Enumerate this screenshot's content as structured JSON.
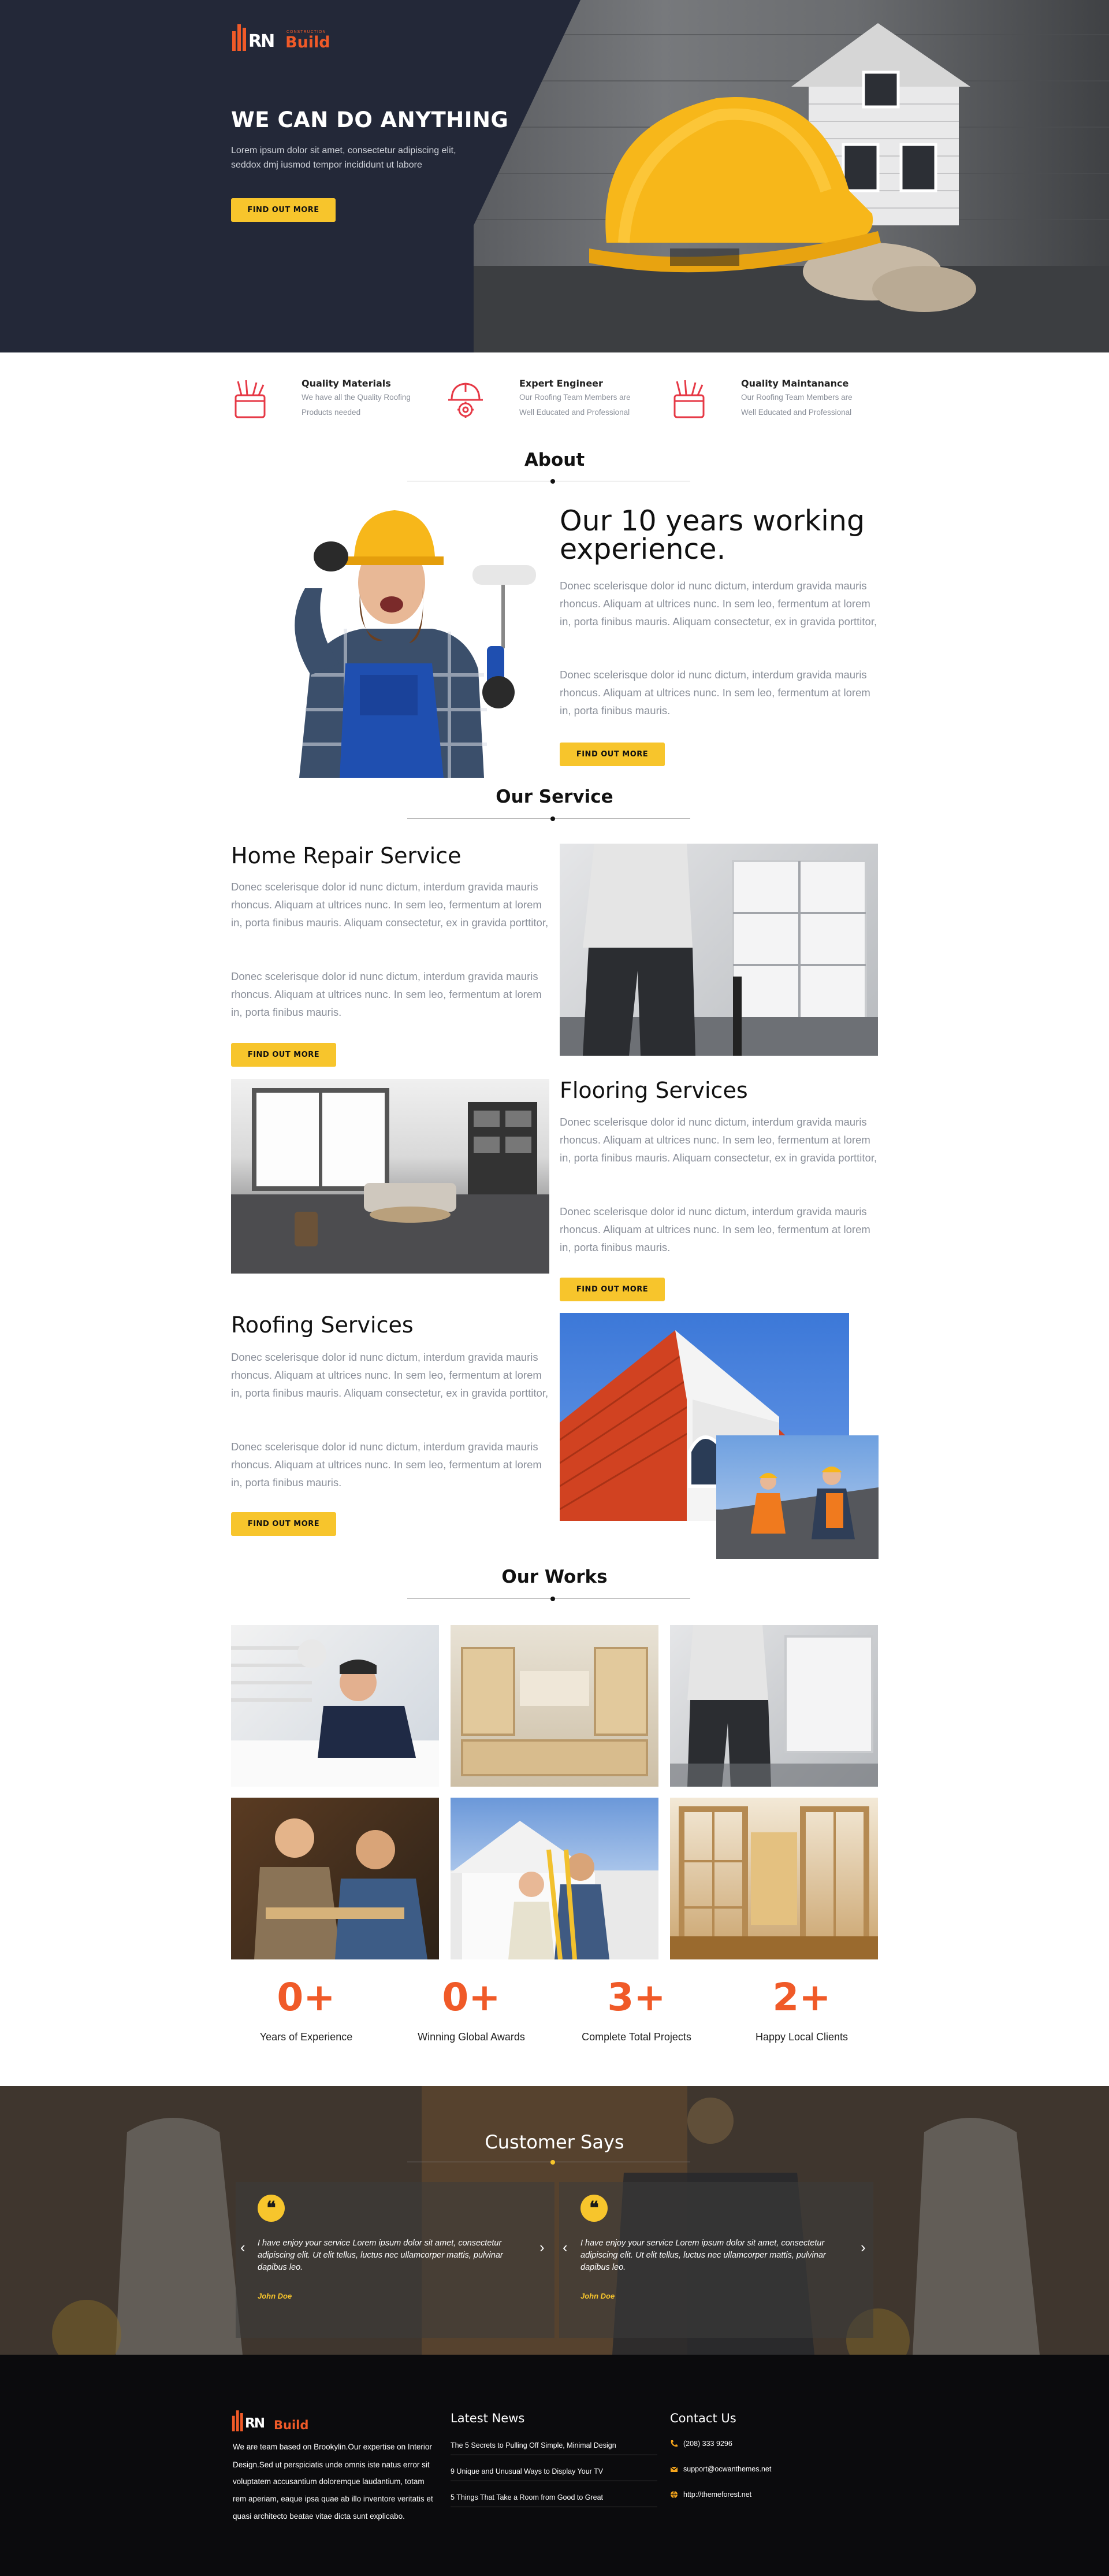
{
  "brand": {
    "logo_text": "Build",
    "tagline": "CONSTRUCTION"
  },
  "hero": {
    "title": "WE CAN DO ANYTHING",
    "text_line1": "Lorem ipsum dolor sit amet, consectetur adipiscing elit,",
    "text_line2": "seddox dmj iusmod tempor incididunt ut labore",
    "button": "FIND OUT MORE"
  },
  "features": [
    {
      "title": "Quality Materials",
      "line1": "We have all the Quality Roofing",
      "line2": "Products needed",
      "icon": "toolbox-icon"
    },
    {
      "title": "Expert Engineer",
      "line1": "Our Roofing Team Members are",
      "line2": "Well Educated and Professional",
      "icon": "hardhat-gear-icon"
    },
    {
      "title": "Quality Maintanance",
      "line1": "Our Roofing Team Members are",
      "line2": "Well Educated and Professional",
      "icon": "toolbox-icon"
    }
  ],
  "about": {
    "section_title": "About",
    "heading_line1": "Our 10 years working",
    "heading_line2": "experience.",
    "para1": "Donec scelerisque dolor id nunc dictum, interdum gravida mauris rhoncus. Aliquam at ultrices nunc. In sem leo, fermentum at lorem in, porta finibus mauris. Aliquam consectetur, ex in gravida porttitor,",
    "para2": "Donec scelerisque dolor id nunc dictum, interdum gravida mauris rhoncus. Aliquam at ultrices nunc. In sem leo, fermentum at lorem in, porta finibus mauris.",
    "button": "FIND OUT MORE"
  },
  "services": {
    "section_title": "Our Service",
    "items": [
      {
        "title": "Home Repair Service",
        "para1": "Donec scelerisque dolor id nunc dictum, interdum gravida mauris rhoncus. Aliquam at ultrices nunc. In sem leo, fermentum at lorem in, porta finibus mauris. Aliquam consectetur, ex in gravida porttitor,",
        "para2": "Donec scelerisque dolor id nunc dictum, interdum gravida mauris rhoncus. Aliquam at ultrices nunc. In sem leo, fermentum at lorem in, porta finibus mauris.",
        "button": "FIND OUT MORE"
      },
      {
        "title": "Flooring Services",
        "para1": "Donec scelerisque dolor id nunc dictum, interdum gravida mauris rhoncus. Aliquam at ultrices nunc. In sem leo, fermentum at lorem in, porta finibus mauris. Aliquam consectetur, ex in gravida porttitor,",
        "para2": "Donec scelerisque dolor id nunc dictum, interdum gravida mauris rhoncus. Aliquam at ultrices nunc. In sem leo, fermentum at lorem in, porta finibus mauris.",
        "button": "FIND OUT MORE"
      },
      {
        "title": "Roofing Services",
        "para1": "Donec scelerisque dolor id nunc dictum, interdum gravida mauris rhoncus. Aliquam at ultrices nunc. In sem leo, fermentum at lorem in, porta finibus mauris. Aliquam consectetur, ex in gravida porttitor,",
        "para2": "Donec scelerisque dolor id nunc dictum, interdum gravida mauris rhoncus. Aliquam at ultrices nunc. In sem leo, fermentum at lorem in, porta finibus mauris.",
        "button": "FIND OUT MORE"
      }
    ]
  },
  "works": {
    "section_title": "Our Works"
  },
  "counters": [
    {
      "value": "0+",
      "label": "Years of Experience"
    },
    {
      "value": "0+",
      "label": "Winning Global Awards"
    },
    {
      "value": "3+",
      "label": "Complete Total Projects"
    },
    {
      "value": "2+",
      "label": "Happy Local Clients"
    }
  ],
  "testimonials": {
    "section_title": "Customer Says",
    "items": [
      {
        "quote": "I have enjoy your service Lorem ipsum dolor sit amet, consectetur adipiscing elit. Ut elit tellus, luctus nec ullamcorper mattis, pulvinar dapibus leo.",
        "author": "John Doe"
      },
      {
        "quote": "I have enjoy your service Lorem ipsum dolor sit amet, consectetur adipiscing elit. Ut elit tellus, luctus nec ullamcorper mattis, pulvinar dapibus leo.",
        "author": "John Doe"
      }
    ],
    "prev": "‹",
    "next": "›"
  },
  "footer": {
    "about_line1": "We are team based on Brookylin.Our expertise on Interior",
    "about_line2": "Design.Sed ut perspiciatis unde omnis iste natus error sit",
    "about_line3": "voluptatem accusantium doloremque laudantium, totam",
    "about_line4": "rem aperiam, eaque ipsa quae ab illo inventore veritatis et",
    "about_line5": "quasi architecto beatae vitae dicta sunt explicabo.",
    "news_title": "Latest News",
    "news": [
      "The 5 Secrets to Pulling Off Simple, Minimal Design",
      "9 Unique and Unusual Ways to Display Your TV",
      "5 Things That Take a Room from Good to Great"
    ],
    "contact_title": "Contact Us",
    "phone": "(208) 333 9296",
    "email": "support@ocwanthemes.net",
    "website": "http://themeforest.net"
  },
  "colors": {
    "dark": "#232838",
    "accent": "#f7c52c",
    "orange": "#f05a28",
    "footer": "#0b0b0d"
  }
}
